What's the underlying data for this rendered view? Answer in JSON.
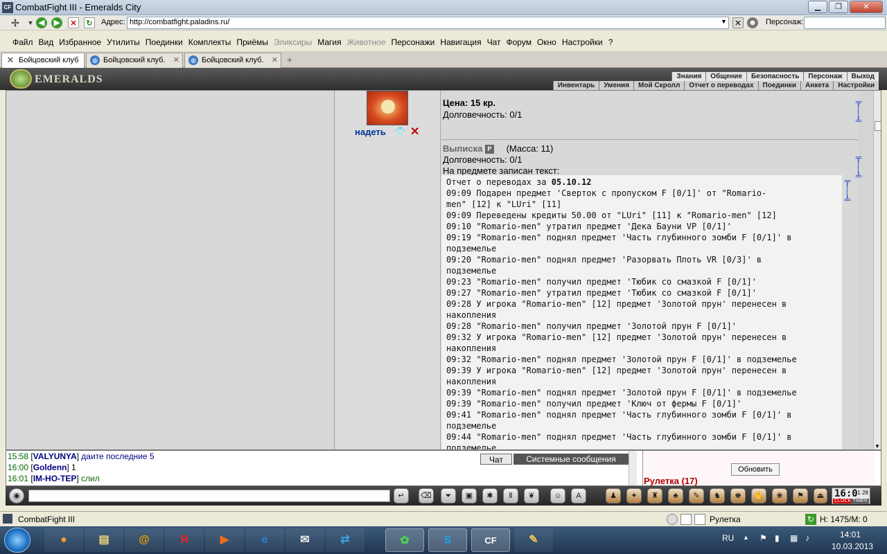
{
  "window": {
    "title": "CombatFight III - Emeralds City",
    "app_icon": "CF",
    "controls": [
      "minimize-icon",
      "restore-icon",
      "close-icon"
    ]
  },
  "addressbar": {
    "label": "Адрес:",
    "url": "http://combatfight.paladins.ru/",
    "persona_label": "Персонаж:",
    "persona_value": ""
  },
  "menu": [
    {
      "label": "Файл",
      "enabled": true
    },
    {
      "label": "Вид",
      "enabled": true
    },
    {
      "label": "Избранное",
      "enabled": true
    },
    {
      "label": "Утилиты",
      "enabled": true
    },
    {
      "label": "Поединки",
      "enabled": true
    },
    {
      "label": "Комплекты",
      "enabled": true
    },
    {
      "label": "Приёмы",
      "enabled": true
    },
    {
      "label": "Эликсиры",
      "enabled": false
    },
    {
      "label": "Магия",
      "enabled": true
    },
    {
      "label": "Животное",
      "enabled": false
    },
    {
      "label": "Персонажи",
      "enabled": true
    },
    {
      "label": "Навигация",
      "enabled": true
    },
    {
      "label": "Чат",
      "enabled": true
    },
    {
      "label": "Форум",
      "enabled": true
    },
    {
      "label": "Окно",
      "enabled": true
    },
    {
      "label": "Настройки",
      "enabled": true
    },
    {
      "label": "?",
      "enabled": true
    }
  ],
  "tabs": [
    {
      "label": "Бойцовский клуб",
      "active": true
    },
    {
      "label": "Бойцовский клуб.",
      "active": false
    },
    {
      "label": "Бойцовский клуб.",
      "active": false
    }
  ],
  "game_header": {
    "logo_text": "EMERALDS",
    "nav_top": [
      "Знания",
      "Общение",
      "Безопасность",
      "Персонаж",
      "Выход"
    ],
    "nav_bottom": [
      "Инвентарь",
      "Умения",
      "Мой Скролл",
      "Отчет о переводах",
      "Поединки",
      "Анкета",
      "Настройки"
    ]
  },
  "item1": {
    "price": "Цена: 15 кр.",
    "durability": "Долговечность: 0/1",
    "wear_link": "надеть"
  },
  "item2": {
    "name": "Выписка",
    "badge": "P",
    "mass": "(Масса: 11)",
    "durability": "Долговечность: 0/1",
    "inscription_label": "На предмете записан текст:",
    "report_title": "Отчет о переводах за",
    "report_date": "05.10.12",
    "lines": [
      "09:09 Подарен предмет 'Сверток с пропуском F [0/1]' от \"Romario-",
      "men\" [12] к \"LUri\" [11]",
      "09:09 Переведены кредиты 50.00 от \"LUri\" [11] к \"Romario-men\" [12]",
      "09:10 \"Romario-men\" утратил предмет 'Дека Бауни VP [0/1]'",
      "09:19 \"Romario-men\" поднял предмет 'Часть глубинного зомби F [0/1]' в",
      "подземелье",
      "09:20 \"Romario-men\" поднял предмет 'Разорвать Плоть VR [0/3]' в",
      "подземелье",
      "09:23 \"Romario-men\" получил предмет 'Тюбик со смазкой F [0/1]'",
      "09:27 \"Romario-men\" утратил предмет 'Тюбик со смазкой F [0/1]'",
      "09:28 У игрока \"Romario-men\" [12] предмет 'Золотой прун' перенесен в",
      "накопления",
      "09:28 \"Romario-men\" получил предмет 'Золотой прун F [0/1]'",
      "09:32 У игрока \"Romario-men\" [12] предмет 'Золотой прун' перенесен в",
      "накопления",
      "09:32 \"Romario-men\" поднял предмет 'Золотой прун F [0/1]' в подземелье",
      "09:39 У игрока \"Romario-men\" [12] предмет 'Золотой прун' перенесен в",
      "накопления",
      "09:39 \"Romario-men\" поднял предмет 'Золотой прун F [0/1]' в подземелье",
      "09:39 \"Romario-men\" получил предмет 'Ключ от фермы F [0/1]'",
      "09:41 \"Romario-men\" поднял предмет 'Часть глубинного зомби F [0/1]' в",
      "подземелье",
      "09:44 \"Romario-men\" поднял предмет 'Часть глубинного зомби F [0/1]' в",
      "подземелье"
    ]
  },
  "chat": {
    "messages": [
      {
        "time": "15:58",
        "nick": "VALYUNYA",
        "text": "даите последние 5",
        "color": "blue"
      },
      {
        "time": "16:00",
        "nick": "Goldenn",
        "text": "1",
        "color": "black"
      },
      {
        "time": "16:01",
        "nick": "IM-HO-TEP",
        "text": "слил",
        "color": "green"
      }
    ],
    "tab_chat": "Чат",
    "tab_system": "Системные сообщения",
    "refresh_button": "Обновить",
    "roulette": "Рулетка (17)"
  },
  "clock": {
    "time": "16:0",
    "small": "1 28",
    "label_clock": "CLOCK",
    "label_timer": "TIMER"
  },
  "status": {
    "app": "CombatFight III",
    "location": "Рулетка",
    "hp": "H: 1475/M: 0"
  },
  "taskbar": {
    "lang": "RU",
    "time": "14:01",
    "date": "10.03.2013"
  },
  "colors": {
    "link": "#003399",
    "delete": "#c00000",
    "roulette": "#b00000",
    "chat_time": "#006600",
    "chat_nick": "#000080"
  }
}
